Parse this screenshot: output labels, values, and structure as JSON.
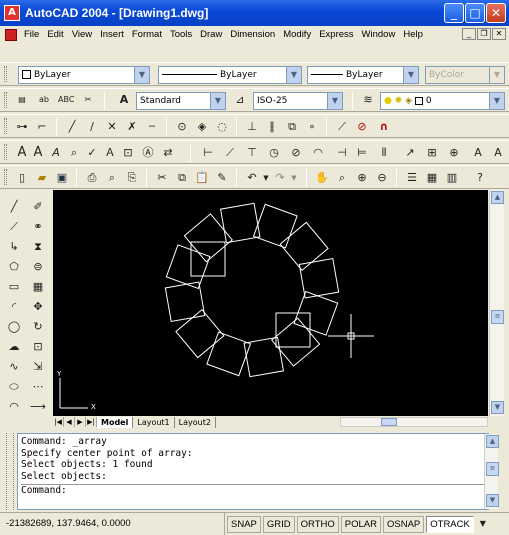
{
  "window": {
    "title": "AutoCAD 2004 - [Drawing1.dwg]",
    "app_icon": "A",
    "min": "_",
    "max": "□",
    "close": "✕"
  },
  "menu": [
    "File",
    "Edit",
    "View",
    "Insert",
    "Format",
    "Tools",
    "Draw",
    "Dimension",
    "Modify",
    "Express",
    "Window",
    "Help"
  ],
  "doc_controls": {
    "min": "_",
    "restore": "❐",
    "close": "✕"
  },
  "properties": {
    "color": "ByLayer",
    "linetype": "ByLayer",
    "lineweight": "ByLayer",
    "plotstyle": "ByColor"
  },
  "styles": {
    "text_style": "Standard",
    "dim_style": "ISO-25",
    "layer": "0"
  },
  "layout_tabs": [
    "Model",
    "Layout1",
    "Layout2"
  ],
  "command_lines": [
    "Command: _array",
    "Specify center point of array:",
    "Select objects: 1 found",
    "Select objects:"
  ],
  "command_prompt": "Command:",
  "status": {
    "coords": "-21382689, 137.9464, 0.0000",
    "toggles": [
      "SNAP",
      "GRID",
      "ORTHO",
      "POLAR",
      "OSNAP",
      "OTRACK"
    ]
  },
  "ucs": {
    "y": "Y",
    "x": "X"
  }
}
